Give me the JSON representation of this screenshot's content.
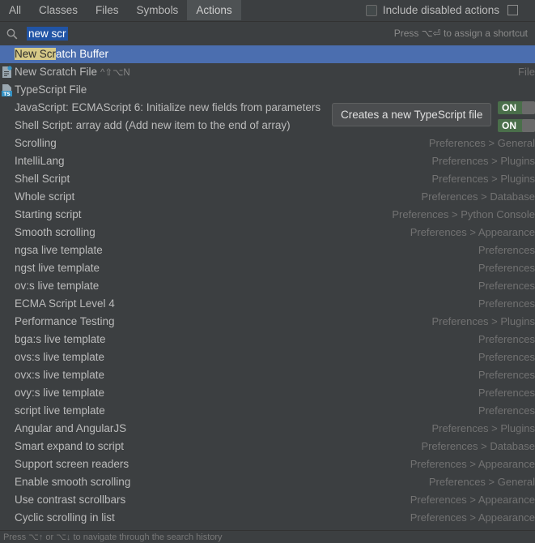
{
  "tabs": [
    "All",
    "Classes",
    "Files",
    "Symbols",
    "Actions"
  ],
  "active_tab": "Actions",
  "include_disabled_label": "Include disabled actions",
  "search": {
    "query": "new scr",
    "hint": "Press ⌥⏎ to assign a shortcut",
    "icon": "search-icon"
  },
  "tooltip": "Creates a new TypeScript file",
  "toggle_label": "ON",
  "rows": [
    {
      "label": "New Scratch Buffer",
      "location": ""
    },
    {
      "label": "New Scratch File",
      "shortcut": "^⇧⌥N",
      "location": "File",
      "icon": "scratch-file-icon"
    },
    {
      "label": "TypeScript File",
      "location": "",
      "icon": "typescript-file-icon"
    },
    {
      "label": "JavaScript: ECMAScript 6: Initialize new fields from parameters",
      "location": ""
    },
    {
      "label": "Shell Script: array add (Add new item to the end of array)",
      "location": ""
    },
    {
      "label": "Scrolling",
      "location": "Preferences > General"
    },
    {
      "label": "IntelliLang",
      "location": "Preferences > Plugins"
    },
    {
      "label": "Shell Script",
      "location": "Preferences > Plugins"
    },
    {
      "label": "Whole script",
      "location": "Preferences > Database"
    },
    {
      "label": "Starting script",
      "location": "Preferences > Python Console"
    },
    {
      "label": "Smooth scrolling",
      "location": "Preferences > Appearance"
    },
    {
      "label": "ngsa live template",
      "location": "Preferences"
    },
    {
      "label": "ngst live template",
      "location": "Preferences"
    },
    {
      "label": "ov:s live template",
      "location": "Preferences"
    },
    {
      "label": "ECMA Script Level 4",
      "location": "Preferences"
    },
    {
      "label": "Performance Testing",
      "location": "Preferences > Plugins"
    },
    {
      "label": "bga:s live template",
      "location": "Preferences"
    },
    {
      "label": "ovs:s live template",
      "location": "Preferences"
    },
    {
      "label": "ovx:s live template",
      "location": "Preferences"
    },
    {
      "label": "ovy:s live template",
      "location": "Preferences"
    },
    {
      "label": "script live template",
      "location": "Preferences"
    },
    {
      "label": "Angular and AngularJS",
      "location": "Preferences > Plugins"
    },
    {
      "label": "Smart expand to script",
      "location": "Preferences > Database"
    },
    {
      "label": "Support screen readers",
      "location": "Preferences > Appearance"
    },
    {
      "label": "Enable smooth scrolling",
      "location": "Preferences > General"
    },
    {
      "label": "Use contrast scrollbars",
      "location": "Preferences > Appearance"
    },
    {
      "label": "Cyclic scrolling in list",
      "location": "Preferences > Appearance"
    }
  ],
  "footer": "Press ⌥↑ or ⌥↓ to navigate through the search history",
  "colors": {
    "background": "#3c3f41",
    "selection": "#4b6eaf",
    "match_highlight": "#d6c987",
    "toggle_on": "#4a6f4a"
  }
}
